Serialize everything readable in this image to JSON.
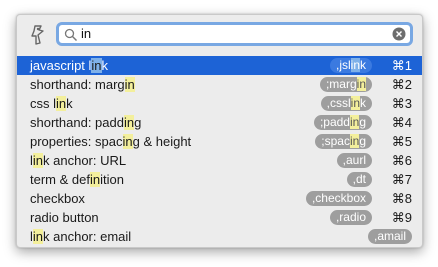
{
  "search": {
    "value": "in",
    "placeholder": ""
  },
  "results": [
    {
      "parts": [
        "javascript l",
        "in",
        "k"
      ],
      "abbr_parts": [
        ",jsl",
        "in",
        "k"
      ],
      "shortcut": "⌘1",
      "selected": true
    },
    {
      "parts": [
        "shorthand: marg",
        "in",
        ""
      ],
      "abbr_parts": [
        ";marg",
        "in",
        ""
      ],
      "shortcut": "⌘2"
    },
    {
      "parts": [
        "css l",
        "in",
        "k"
      ],
      "abbr_parts": [
        ",cssl",
        "in",
        "k"
      ],
      "shortcut": "⌘3"
    },
    {
      "parts": [
        "shorthand: padd",
        "in",
        "g"
      ],
      "abbr_parts": [
        ";padd",
        "in",
        "g"
      ],
      "shortcut": "⌘4"
    },
    {
      "parts": [
        "properties: spac",
        "in",
        "g & height"
      ],
      "abbr_parts": [
        ";spac",
        "in",
        "g"
      ],
      "shortcut": "⌘5"
    },
    {
      "parts": [
        "l",
        "in",
        "k anchor: URL"
      ],
      "abbr_parts": [
        ",aurl",
        "",
        ""
      ],
      "shortcut": "⌘6"
    },
    {
      "parts": [
        "term & def",
        "in",
        "ition"
      ],
      "abbr_parts": [
        ",dt",
        "",
        ""
      ],
      "shortcut": "⌘7"
    },
    {
      "parts": [
        "checkbox",
        "",
        ""
      ],
      "abbr_parts": [
        ",checkbox",
        "",
        ""
      ],
      "shortcut": "⌘8"
    },
    {
      "parts": [
        "radio button",
        "",
        ""
      ],
      "abbr_parts": [
        ",radio",
        "",
        ""
      ],
      "shortcut": "⌘9"
    },
    {
      "parts": [
        "l",
        "in",
        "k anchor: email"
      ],
      "abbr_parts": [
        ",amail",
        "",
        ""
      ],
      "shortcut": ""
    }
  ],
  "icons": {
    "app": "tag-logo-icon",
    "search": "search-icon",
    "clear": "clear-icon"
  },
  "colors": {
    "selection": "#1d63d6",
    "highlight": "#f3ef9c",
    "pill": "#9e9e9e",
    "focus_ring": "#79a8e3"
  }
}
